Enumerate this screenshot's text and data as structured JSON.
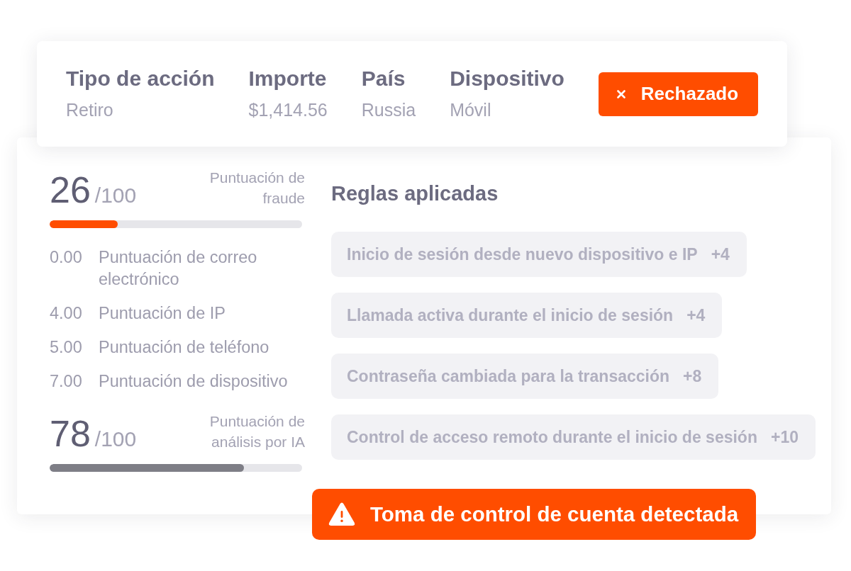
{
  "transaction": {
    "fields": [
      {
        "label": "Tipo de acción",
        "value": "Retiro"
      },
      {
        "label": "Importe",
        "value": "$1,414.56"
      },
      {
        "label": "País",
        "value": "Russia"
      },
      {
        "label": "Dispositivo",
        "value": "Móvil"
      }
    ],
    "status": {
      "label": "Rechazado"
    }
  },
  "score_panel": [
    {
      "kind": "score",
      "value": "26",
      "max": "/100",
      "label": "Puntuación de fraude",
      "level": 0.27,
      "color": "#ff4d00"
    },
    {
      "kind": "breakdown",
      "rows": [
        {
          "value": "0.00",
          "label": "Puntuación de correo electrónico"
        },
        {
          "value": "4.00",
          "label": "Puntuación de IP"
        },
        {
          "value": "5.00",
          "label": "Puntuación de teléfono"
        },
        {
          "value": "7.00",
          "label": "Puntuación de dispositivo"
        }
      ]
    },
    {
      "kind": "score",
      "value": "78",
      "max": "/100",
      "label": "Puntuación de análisis por IA",
      "level": 0.77,
      "color": "#7e7e86"
    }
  ],
  "rules": {
    "title": "Reglas aplicadas",
    "items": [
      {
        "text": "Inicio de sesión desde nuevo dispositivo e IP",
        "points": "+4"
      },
      {
        "text": "Llamada activa durante el inicio de sesión",
        "points": "+4"
      },
      {
        "text": "Contraseña cambiada para la transacción",
        "points": "+8"
      },
      {
        "text": "Control de acceso remoto durante el inicio de sesión",
        "points": "+10"
      }
    ]
  },
  "alert": {
    "text": "Toma de control de cuenta detectada"
  }
}
